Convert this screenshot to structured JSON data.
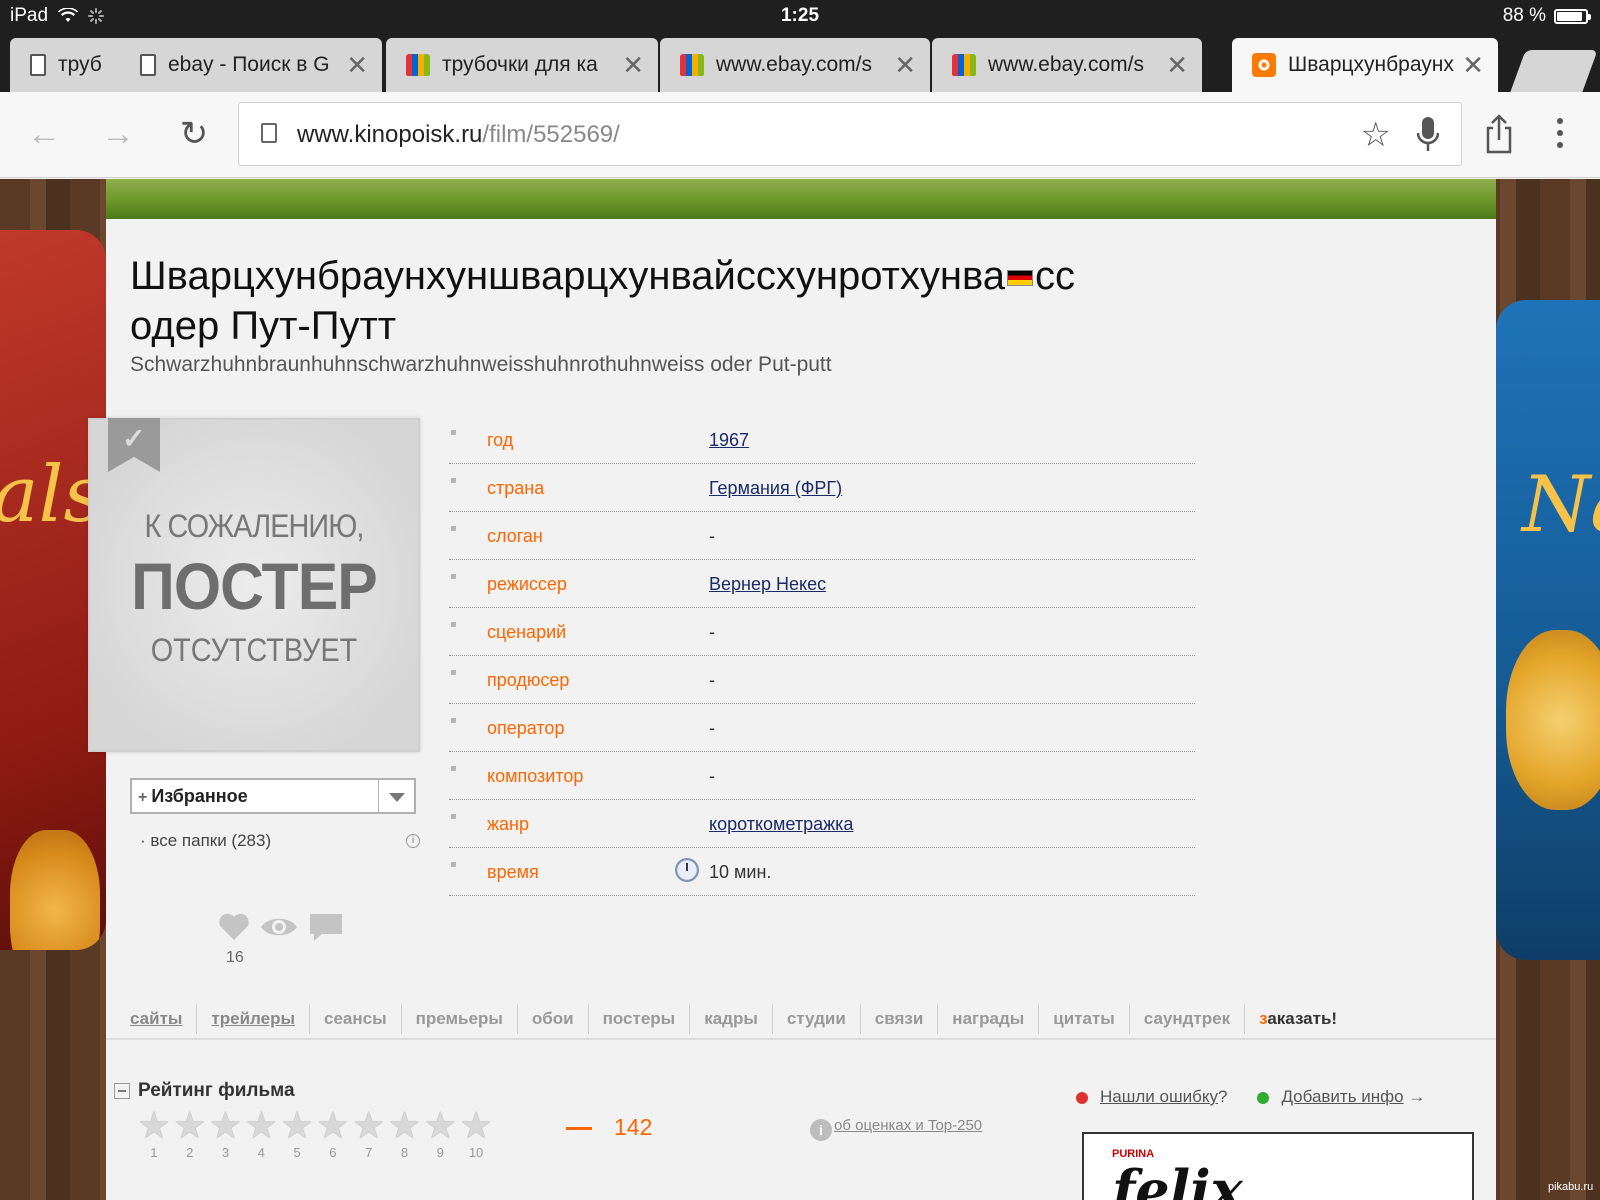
{
  "status_bar": {
    "device": "iPad",
    "time": "1:25",
    "battery": "88 %",
    "battery_level": 0.88
  },
  "tabs": [
    {
      "label": "труб",
      "icon": "page-icon",
      "close": ""
    },
    {
      "label": "ebay - Поиск в G",
      "icon": "page-icon",
      "close": "✕"
    },
    {
      "label": "трубочки для ка",
      "icon": "ebay-icon",
      "close": "✕"
    },
    {
      "label": "www.ebay.com/s",
      "icon": "ebay-icon",
      "close": "✕"
    },
    {
      "label": "www.ebay.com/s",
      "icon": "ebay-icon",
      "close": "✕"
    },
    {
      "label": "Шварцхунбраунх",
      "icon": "kinopoisk-icon",
      "close": "✕",
      "active": true
    }
  ],
  "toolbar": {
    "back": "←",
    "forward": "→",
    "reload": "↻",
    "url_host": "www.kinopoisk.ru",
    "url_path": "/film/552569/",
    "star": "☆"
  },
  "film": {
    "title_ru_line1": "Шварцхунбраунхуншварцхунвайссхунротхунва",
    "title_ru_line1_end": "сс",
    "title_ru_line2": "одер Пут-Путт",
    "title_original": "Schwarzhuhnbraunhuhnschwarzhuhnweisshuhnrothuhnweiss oder Put-putt"
  },
  "poster": {
    "line1": "К СОЖАЛЕНИЮ,",
    "line2": "ПОСТЕР",
    "line3": "ОТСУТСТВУЕТ"
  },
  "favorites": {
    "plus": "+",
    "label": "Избранное",
    "folders": "все папки (283)",
    "info": "i",
    "likes": "16"
  },
  "info_rows": [
    {
      "key": "год",
      "value": "1967",
      "link": true
    },
    {
      "key": "страна",
      "value": "Германия (ФРГ)",
      "link": true
    },
    {
      "key": "слоган",
      "value": "-",
      "link": false
    },
    {
      "key": "режиссер",
      "value": "Вернер Некес",
      "link": true
    },
    {
      "key": "сценарий",
      "value": "-",
      "link": false
    },
    {
      "key": "продюсер",
      "value": "-",
      "link": false
    },
    {
      "key": "оператор",
      "value": "-",
      "link": false
    },
    {
      "key": "композитор",
      "value": "-",
      "link": false
    },
    {
      "key": "жанр",
      "value": "короткометражка",
      "link": true
    },
    {
      "key": "время",
      "value": "10 мин.",
      "link": false
    }
  ],
  "nav_links": [
    {
      "label": "сайты",
      "underline": true
    },
    {
      "label": "трейлеры",
      "underline": true
    },
    {
      "label": "сеансы",
      "underline": false
    },
    {
      "label": "премьеры",
      "underline": false
    },
    {
      "label": "обои",
      "underline": false
    },
    {
      "label": "постеры",
      "underline": false
    },
    {
      "label": "кадры",
      "underline": false
    },
    {
      "label": "студии",
      "underline": false
    },
    {
      "label": "связи",
      "underline": false
    },
    {
      "label": "награды",
      "underline": false
    },
    {
      "label": "цитаты",
      "underline": false
    },
    {
      "label": "саундтрек",
      "underline": false
    }
  ],
  "order": {
    "first": "з",
    "rest": "аказать!"
  },
  "rating": {
    "title": "Рейтинг фильма",
    "star_glyph": "★",
    "star_numbers": [
      "1",
      "2",
      "3",
      "4",
      "5",
      "6",
      "7",
      "8",
      "9",
      "10"
    ],
    "votes": "142",
    "about": "об оценках и Top-250",
    "about_icon": "i"
  },
  "feedback": {
    "error_link": "Нашли ошибку",
    "error_suffix": "?",
    "add_link": "Добавить инфо",
    "add_arrow": "→"
  },
  "ad": {
    "brand_small": "PURINA",
    "brand": "felix"
  },
  "watermark": "pikabu.ru",
  "colors": {
    "accent": "#ff6600",
    "link": "#1a2a66"
  }
}
